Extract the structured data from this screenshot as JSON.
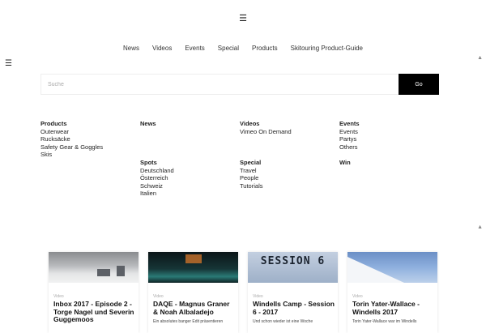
{
  "header": {
    "menu_icon": "☰",
    "side_menu_icon": "☰",
    "scroll_icon": "▲"
  },
  "nav": [
    "News",
    "Videos",
    "Events",
    "Special",
    "Products",
    "Skitouring Product-Guide"
  ],
  "search": {
    "placeholder": "Suche",
    "button": "Go"
  },
  "menu": [
    {
      "title": "Products",
      "items": [
        "Outerwear",
        "Rucksäcke",
        "Safety Gear & Goggles",
        "Skis"
      ]
    },
    {
      "title": "News",
      "items": []
    },
    {
      "title": "Videos",
      "items": [
        "Vimeo On Demand"
      ]
    },
    {
      "title": "Events",
      "items": [
        "Events",
        "Partys",
        "Others"
      ]
    },
    {
      "title": "Spots",
      "items": [
        "Deutschland",
        "Österreich",
        "Schweiz",
        "Italien"
      ]
    },
    {
      "title": "Special",
      "items": [
        "Travel",
        "People",
        "Tutorials"
      ]
    },
    {
      "title": "Win",
      "items": []
    }
  ],
  "cards": [
    {
      "category": "Video",
      "title": "Inbox 2017 - Episode 2 - Torge Nagel und Severin Guggemoos",
      "excerpt": ""
    },
    {
      "category": "Video",
      "title": "DAQE - Magnus Graner & Noah Albaladejo",
      "excerpt": "Ein absolutes banger Edit präsentieren"
    },
    {
      "category": "Video",
      "title": "Windells Camp - Session 6 - 2017",
      "excerpt": "Und schon wieder ist eine Woche",
      "thumb_text": "SESSION 6"
    },
    {
      "category": "Video",
      "title": "Torin Yater-Wallace - Windells 2017",
      "excerpt": "Torin Yater-Wallace war im Windells"
    }
  ]
}
